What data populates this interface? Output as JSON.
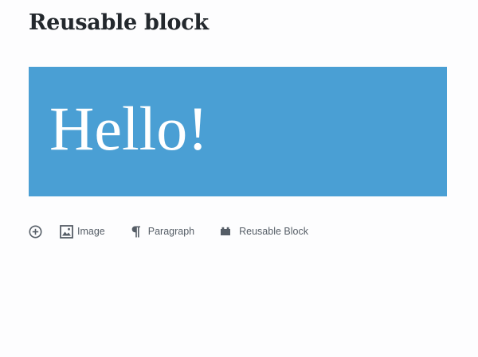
{
  "post": {
    "title": "Reusable block"
  },
  "block": {
    "content": "Hello!",
    "background_color": "#4a9fd4"
  },
  "inserter": {
    "toggle_icon": "plus-circle-icon",
    "suggestions": [
      {
        "label": "Image",
        "icon": "image-icon"
      },
      {
        "label": "Paragraph",
        "icon": "paragraph-icon"
      },
      {
        "label": "Reusable Block",
        "icon": "block-default-icon"
      }
    ]
  }
}
